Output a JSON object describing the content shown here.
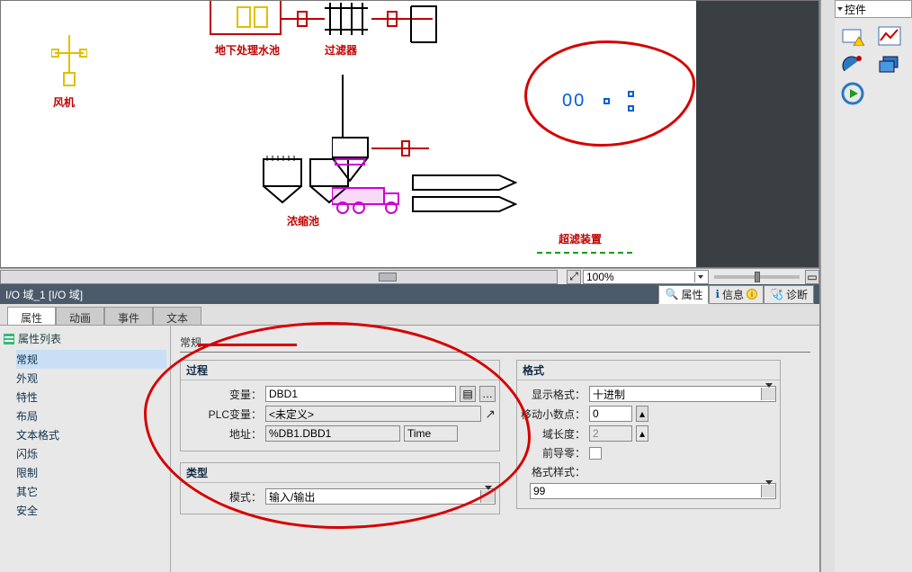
{
  "side_panel": {
    "title": "控件",
    "icons": [
      "chart-warn-icon",
      "line-chart-icon",
      "satellite-icon",
      "screens-icon",
      "media-play-icon"
    ]
  },
  "zoom": {
    "value": "100%"
  },
  "object_bar": {
    "title": "I/O 域_1 [I/O 域]",
    "tabs": {
      "props": "属性",
      "info": "信息",
      "diag": "诊断"
    }
  },
  "prop_tabs": {
    "props": "属性",
    "anim": "动画",
    "events": "事件",
    "text": "文本"
  },
  "prop_nav": {
    "title": "属性列表",
    "items": [
      "常规",
      "外观",
      "特性",
      "布局",
      "文本格式",
      "闪烁",
      "限制",
      "其它",
      "安全"
    ]
  },
  "form": {
    "section": "常规",
    "process": {
      "title": "过程",
      "tag_label": "变量：",
      "tag_value": "DBD1",
      "plc_tag_label": "PLC变量：",
      "plc_tag_value": "<未定义>",
      "addr_label": "地址：",
      "addr_value": "%DB1.DBD1",
      "addr_type": "Time"
    },
    "type": {
      "title": "类型",
      "mode_label": "模式：",
      "mode_value": "输入/输出"
    },
    "format": {
      "title": "格式",
      "disp_label": "显示格式：",
      "disp_value": "十进制",
      "shift_label": "移动小数点：",
      "shift_value": "0",
      "len_label": "域长度：",
      "len_value": "2",
      "lead_label": "前导零：",
      "pattern_label": "格式样式：",
      "pattern_value": "99"
    }
  },
  "schematic": {
    "fan": "风机",
    "pond": "地下处理水池",
    "filter": "过滤器",
    "thickener": "浓缩池",
    "ultra": "超滤装置",
    "io_placeholder": "00"
  }
}
